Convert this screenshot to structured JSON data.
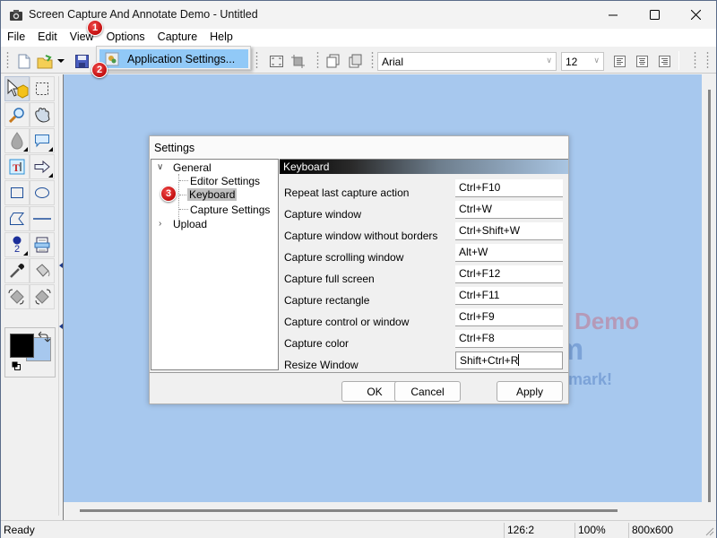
{
  "window": {
    "title": "Screen Capture And Annotate Demo - Untitled",
    "controls": {
      "minimize": "minimize",
      "maximize": "maximize",
      "close": "close"
    }
  },
  "menubar": {
    "items": [
      {
        "label": "File"
      },
      {
        "label": "Edit"
      },
      {
        "label": "View"
      },
      {
        "label": "Options"
      },
      {
        "label": "Capture"
      },
      {
        "label": "Help"
      }
    ]
  },
  "options_menu": {
    "items": [
      {
        "label": "Application Settings...",
        "icon": "settings-icon"
      }
    ]
  },
  "toolbar": {
    "font_name": "Arial",
    "font_size": "12"
  },
  "badges": [
    "1",
    "2",
    "3"
  ],
  "palette": {
    "color_number_label": "2",
    "foreground_color": "#000000",
    "background_color": "#a7c8ee"
  },
  "canvas": {
    "background_color": "#a7c8ee",
    "watermark_line1": "Demo",
    "watermark_line2": "m",
    "watermark_line3": "rmark!"
  },
  "statusbar": {
    "status": "Ready",
    "position": "126:2",
    "zoom": "100%",
    "size": "800x600"
  },
  "settings_dialog": {
    "title": "Settings",
    "tree": {
      "general": "General",
      "children": [
        "Editor Settings",
        "Keyboard",
        "Capture Settings"
      ],
      "upload": "Upload",
      "selected": "Keyboard"
    },
    "panel_title": "Keyboard",
    "shortcuts": [
      {
        "action": "Repeat last capture action",
        "keys": "Ctrl+F10"
      },
      {
        "action": "Capture window",
        "keys": "Ctrl+W"
      },
      {
        "action": "Capture window without borders",
        "keys": "Ctrl+Shift+W"
      },
      {
        "action": "Capture scrolling window",
        "keys": "Alt+W"
      },
      {
        "action": "Capture full screen",
        "keys": "Ctrl+F12"
      },
      {
        "action": "Capture rectangle",
        "keys": "Ctrl+F11"
      },
      {
        "action": "Capture control or window",
        "keys": "Ctrl+F9"
      },
      {
        "action": "Capture color",
        "keys": "Ctrl+F8"
      },
      {
        "action": "Resize Window",
        "keys": "Shift+Ctrl+R"
      }
    ],
    "buttons": {
      "ok": "OK",
      "cancel": "Cancel",
      "apply": "Apply"
    }
  }
}
